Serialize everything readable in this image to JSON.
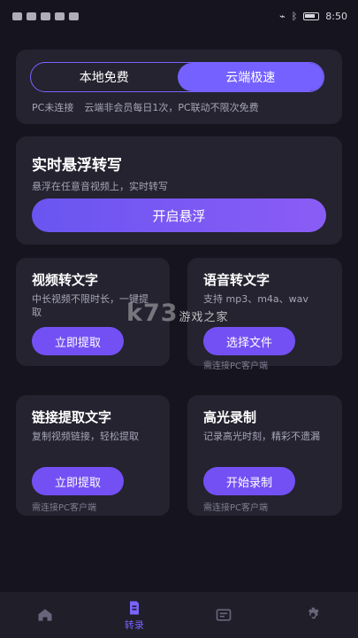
{
  "status": {
    "time": "8:50",
    "icons": [
      "sim-icon",
      "signal-icon",
      "wifi-icon",
      "mail-icon",
      "alarm-icon",
      "key-icon",
      "bluetooth-icon",
      "battery-icon"
    ]
  },
  "mode": {
    "options": [
      "本地免费",
      "云端极速"
    ],
    "selected": "云端极速",
    "note_left": "PC未连接",
    "note_right": "云端非会员每日1次，PC联动不限次免费"
  },
  "float": {
    "title": "实时悬浮转写",
    "description": "悬浮在任意音视频上，实时转写",
    "button": "开启悬浮"
  },
  "features": [
    {
      "title": "视频转文字",
      "description": "中长视频不限时长，一键提取",
      "button": "立即提取",
      "note": ""
    },
    {
      "title": "语音转文字",
      "description": "支持 mp3、m4a、wav",
      "button": "选择文件",
      "note": "需连接PC客户端"
    },
    {
      "title": "链接提取文字",
      "description": "复制视频链接，轻松提取",
      "button": "立即提取",
      "note": "需连接PC客户端"
    },
    {
      "title": "高光录制",
      "description": "记录高光时刻，精彩不遗漏",
      "button": "开始录制",
      "note": "需连接PC客户端"
    }
  ],
  "watermark": {
    "logo": "k73",
    "text": "游戏之家"
  },
  "nav": {
    "items": [
      {
        "icon": "home-icon",
        "label": ""
      },
      {
        "icon": "document-icon",
        "label": "转录"
      },
      {
        "icon": "message-icon",
        "label": ""
      },
      {
        "icon": "settings-icon",
        "label": ""
      }
    ],
    "active": "转录"
  },
  "colors": {
    "background": "#16151f",
    "card": "#24232f",
    "accent": "#7561ff"
  }
}
